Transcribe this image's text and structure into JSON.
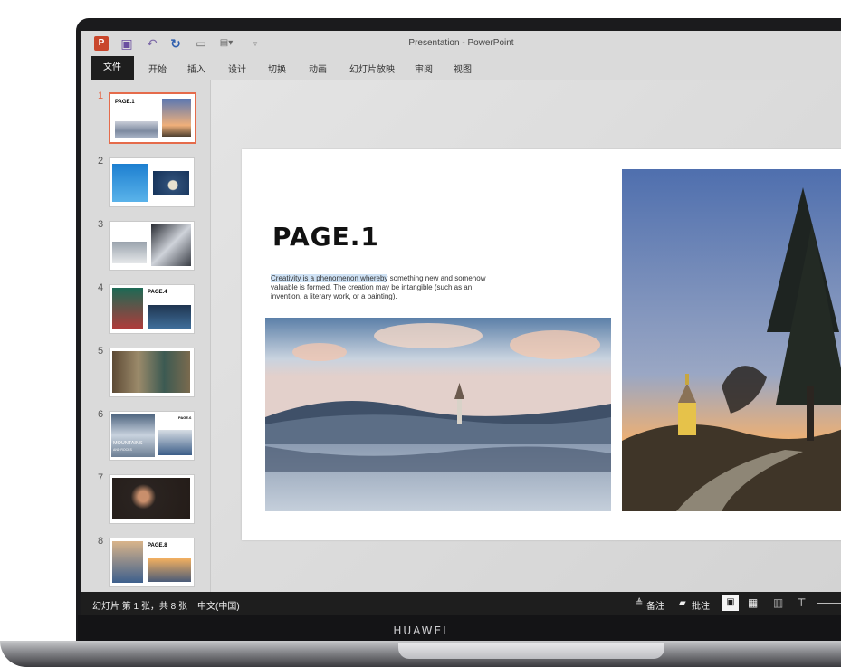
{
  "window": {
    "title": "Presentation - PowerPoint"
  },
  "qat": {
    "icons": [
      "powerpoint-app-icon",
      "save-icon",
      "undo-icon",
      "redo-icon",
      "presenter-icon",
      "customize-icon"
    ]
  },
  "ribbon": {
    "tabs": [
      "文件",
      "开始",
      "插入",
      "设计",
      "切换",
      "动画",
      "幻灯片放映",
      "审阅",
      "视图"
    ]
  },
  "thumbnails": [
    {
      "num": "1",
      "title": "PAGE.1"
    },
    {
      "num": "2"
    },
    {
      "num": "3"
    },
    {
      "num": "4",
      "title": "PAGE.4"
    },
    {
      "num": "5"
    },
    {
      "num": "6",
      "title": "PAGE.6",
      "caption": "MOUNTAINS",
      "sub": "AND ROCKS"
    },
    {
      "num": "7"
    },
    {
      "num": "8",
      "title": "PAGE.8"
    }
  ],
  "slide": {
    "title": "PAGE.1",
    "body_highlight": "Creativity is a phenomenon whereby",
    "body_rest": " something new and somehow valuable is formed. The creation may be intangible (such as an invention, a literary work, or a painting)."
  },
  "status": {
    "slide_info": "幻灯片 第 1 张，共 8 张",
    "language": "中文(中国)",
    "notes": "备注",
    "comments": "批注"
  },
  "device": {
    "brand": "HUAWEI"
  },
  "colors": {
    "accent": "#e56b4b",
    "statusbar": "#1e1e1e",
    "highlight": "#cfe2f5"
  }
}
